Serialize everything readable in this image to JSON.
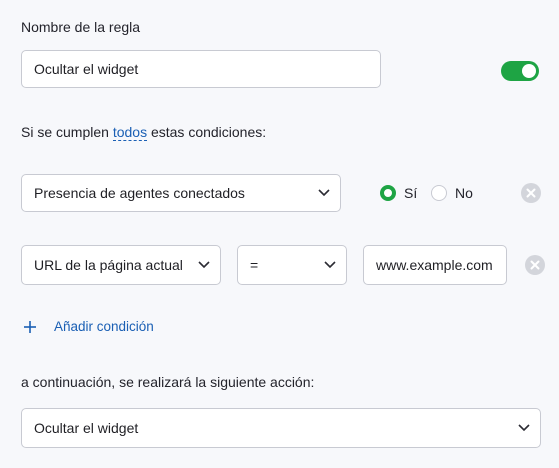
{
  "rule": {
    "name_label": "Nombre de la regla",
    "name_value": "Ocultar el widget",
    "enabled": true
  },
  "conditions_intro": {
    "prefix": "Si se cumplen",
    "link": "todos",
    "suffix": "estas condiciones:"
  },
  "condition1": {
    "select": "Presencia de agentes conectados",
    "option_yes": "Sí",
    "option_no": "No",
    "selected": "Sí"
  },
  "condition2": {
    "field": "URL de la página actual",
    "operator": "=",
    "value": "www.example.com"
  },
  "add_condition": {
    "label": "Añadir condición"
  },
  "action": {
    "label": "a continuación, se realizará la siguiente acción:",
    "select": "Ocultar el widget"
  },
  "colors": {
    "accent_green": "#1ea444",
    "link_blue": "#1a5fb4"
  },
  "icons": {
    "chevron": "chevron-down-icon",
    "remove": "close-circle-icon",
    "add": "plus-icon"
  }
}
